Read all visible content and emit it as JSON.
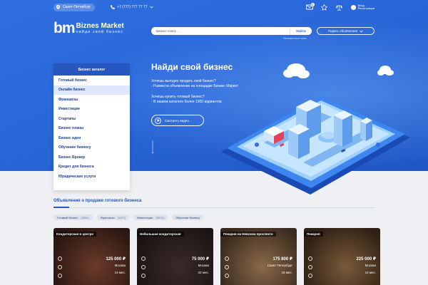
{
  "topbar": {
    "city": "Санкт-Петербург",
    "phone": "+7 (777) 777 77 77",
    "messages_badge": "2",
    "login_line1": "Вход",
    "login_line2": "Регистрация"
  },
  "logo": {
    "mark": "bm",
    "name": "Biznes Market",
    "tagline": "найди свой бизнес"
  },
  "search": {
    "placeholder": "Бизнес поиск ...",
    "button": "Найти",
    "advanced": "Расширенный поиск"
  },
  "post_ad": "Подать объявление",
  "catalog": {
    "title": "Бизнес каталог",
    "items": [
      {
        "label": "Готовый бизнес",
        "active": false
      },
      {
        "label": "Онлайн бизнес",
        "active": true
      },
      {
        "label": "Франшизы",
        "active": false
      },
      {
        "label": "Инвестиции",
        "active": false
      },
      {
        "label": "Стартапы",
        "active": false
      },
      {
        "label": "Бизнес планы",
        "active": false
      },
      {
        "label": "Бизнес идеи",
        "active": false
      },
      {
        "label": "Обучение бизнесу",
        "active": false
      },
      {
        "label": "Бизнес Брокер",
        "active": false
      },
      {
        "label": "Кредит для бизнеса",
        "active": false
      },
      {
        "label": "Юридические услуги",
        "active": false
      }
    ]
  },
  "hero": {
    "title": "Найди свой бизнес",
    "line1": "Хочешь выгодно продать свой бизнес?",
    "line2": "- Размести объявление на площадке Бизнес Маркет",
    "line3": "Хочешь купить готовый бизнес?",
    "line4": "- В нашем каталоге более 1000 вариантов",
    "video_button": "Смотреть видео"
  },
  "section": {
    "title": "Объявления о продаже готового бизнеса"
  },
  "filters": [
    {
      "label": "Готовый бизнес",
      "count": "(3004)"
    },
    {
      "label": "Франшизы",
      "count": "(1427)"
    },
    {
      "label": "Инвестиции",
      "count": "(5012)"
    },
    {
      "label": "Обучение бизнесу",
      "count": ""
    }
  ],
  "cards": [
    {
      "title": "Кондитерская в центре",
      "price": "125 000 ₽",
      "city": "Москва",
      "term": "14 мес.",
      "colors": [
        "#6b3a2a",
        "#2b1712"
      ]
    },
    {
      "title": "Небольшая кондитерская",
      "price": "75 000 ₽",
      "city": "Москва",
      "term": "22 мес.",
      "colors": [
        "#3b2a2a",
        "#1c1414"
      ]
    },
    {
      "title": "Пекарня на Невском проспекте",
      "price": "175 800 ₽",
      "city": "Санкт-Петербург",
      "term": "18 мес.",
      "colors": [
        "#8a6a4a",
        "#3a2a1e"
      ]
    },
    {
      "title": "Пекарня",
      "price": "225 000 ₽",
      "city": "Москва",
      "term": "14 мес.",
      "colors": [
        "#7a5a3a",
        "#2e2014"
      ]
    }
  ],
  "colors": {
    "brand": "#2656c0",
    "hero": "#2a67d8",
    "active_item": "#dfe8fb"
  }
}
